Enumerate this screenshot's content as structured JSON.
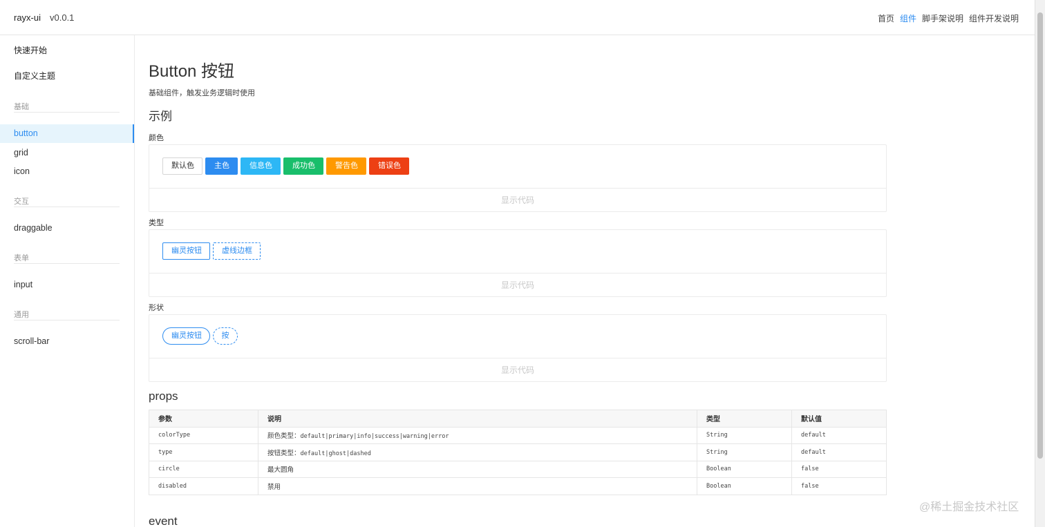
{
  "header": {
    "brand": "rayx-ui",
    "version": "v0.0.1",
    "nav": [
      "首页",
      "组件",
      "脚手架说明",
      "组件开发说明"
    ],
    "active_nav": "组件"
  },
  "sidebar": {
    "top_links": [
      "快速开始",
      "自定义主题"
    ],
    "groups": [
      {
        "title": "基础",
        "items": [
          "button",
          "grid",
          "icon"
        ]
      },
      {
        "title": "交互",
        "items": [
          "draggable"
        ]
      },
      {
        "title": "表单",
        "items": [
          "input"
        ]
      },
      {
        "title": "通用",
        "items": [
          "scroll-bar"
        ]
      }
    ],
    "active_item": "button"
  },
  "main": {
    "title": "Button 按钮",
    "description": "基础组件，触发业务逻辑时使用",
    "examples_heading": "示例",
    "show_code_label": "显示代码",
    "sections": {
      "color": {
        "label": "颜色",
        "buttons": {
          "default": "默认色",
          "primary": "主色",
          "info": "信息色",
          "success": "成功色",
          "warning": "警告色",
          "error": "错误色"
        }
      },
      "type": {
        "label": "类型",
        "buttons": {
          "ghost": "幽灵按钮",
          "dashed": "虚线边框"
        }
      },
      "shape": {
        "label": "形状",
        "buttons": {
          "ghost": "幽灵按钮",
          "dashed": "按"
        }
      }
    },
    "props_heading": "props",
    "props_table": {
      "headers": [
        "参数",
        "说明",
        "类型",
        "默认值"
      ],
      "rows": [
        {
          "name": "colorType",
          "desc_label": "颜色类型：",
          "desc_value": "default|primary|info|success|warning|error",
          "type": "String",
          "default": "default"
        },
        {
          "name": "type",
          "desc_label": "按钮类型：",
          "desc_value": "default|ghost|dashed",
          "type": "String",
          "default": "default"
        },
        {
          "name": "circle",
          "desc_label": "最大圆角",
          "desc_value": "",
          "type": "Boolean",
          "default": "false"
        },
        {
          "name": "disabled",
          "desc_label": "禁用",
          "desc_value": "",
          "type": "Boolean",
          "default": "false"
        }
      ]
    },
    "event_heading": "event"
  },
  "watermark": "@稀土掘金技术社区",
  "colors": {
    "primary": "#2d8cf0",
    "info": "#2db7f5",
    "success": "#19be6b",
    "warning": "#ff9900",
    "error": "#ed4014"
  }
}
